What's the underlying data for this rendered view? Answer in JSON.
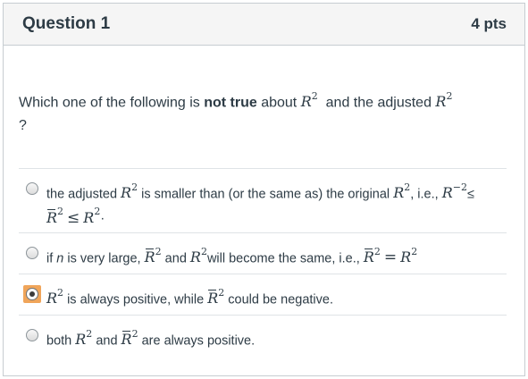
{
  "question": {
    "title": "Question 1",
    "points": "4 pts",
    "text_before": "Which one of the following is ",
    "text_bold": "not true",
    "text_middle": " about ",
    "text_after": " and the adjusted ",
    "text_end": "?"
  },
  "math": {
    "R": "R",
    "sq": "2",
    "le": "≤",
    "eq": "=",
    "neg_two": "−2"
  },
  "answers": [
    {
      "p1": "the adjusted ",
      "p2": " is smaller than (or the same as) the original ",
      "p3": ", i.e., ",
      "p4": "≤",
      "p5": "·",
      "selected": false
    },
    {
      "p1": "if ",
      "p1_italic": "n",
      "p2": " is very large, ",
      "p3": " and ",
      "p4": "will become the same, i.e., ",
      "selected": false
    },
    {
      "p2": " is always positive, while ",
      "p3": " could be negative.",
      "selected": true
    },
    {
      "p1": "both ",
      "p2": " and ",
      "p3": " are always positive.",
      "selected": false
    }
  ]
}
